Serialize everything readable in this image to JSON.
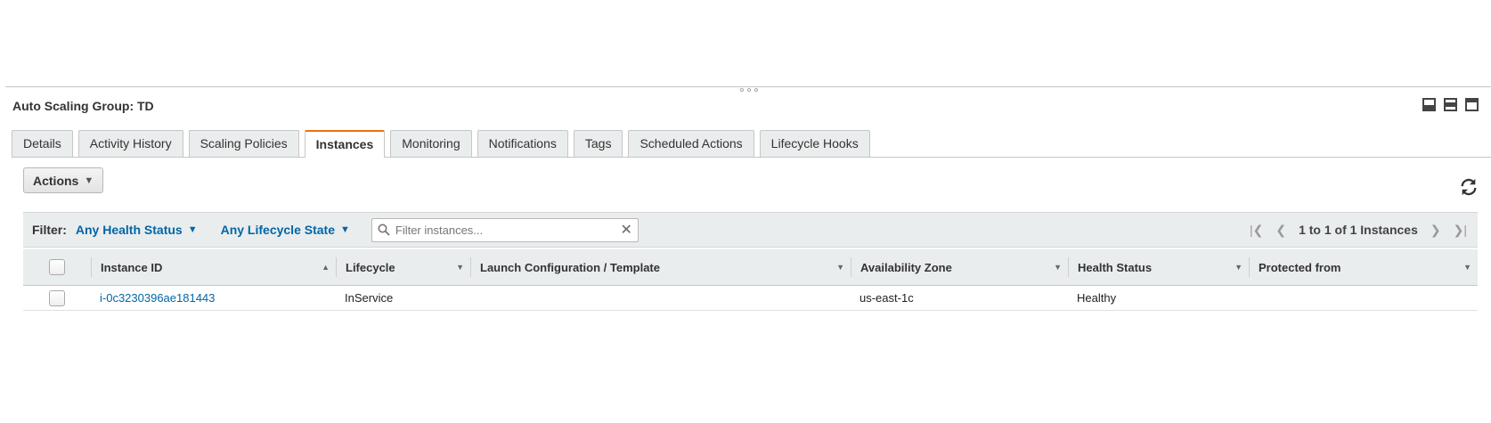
{
  "panel": {
    "title": "Auto Scaling Group: TD"
  },
  "tabs": [
    {
      "label": "Details"
    },
    {
      "label": "Activity History"
    },
    {
      "label": "Scaling Policies"
    },
    {
      "label": "Instances",
      "active": true
    },
    {
      "label": "Monitoring"
    },
    {
      "label": "Notifications"
    },
    {
      "label": "Tags"
    },
    {
      "label": "Scheduled Actions"
    },
    {
      "label": "Lifecycle Hooks"
    }
  ],
  "toolbar": {
    "actions_label": "Actions"
  },
  "filter": {
    "label": "Filter:",
    "health_dropdown": "Any Health Status",
    "lifecycle_dropdown": "Any Lifecycle State",
    "search_placeholder": "Filter instances..."
  },
  "pagination": {
    "text": "1 to 1 of 1 Instances"
  },
  "table": {
    "columns": [
      "Instance ID",
      "Lifecycle",
      "Launch Configuration / Template",
      "Availability Zone",
      "Health Status",
      "Protected from"
    ],
    "rows": [
      {
        "instance_id": "i-0c3230396ae181443",
        "lifecycle": "InService",
        "launch_config": "",
        "availability_zone": "us-east-1c",
        "health_status": "Healthy",
        "protected_from": ""
      }
    ]
  },
  "colors": {
    "accent": "#ec7211",
    "link": "#0066a6"
  }
}
